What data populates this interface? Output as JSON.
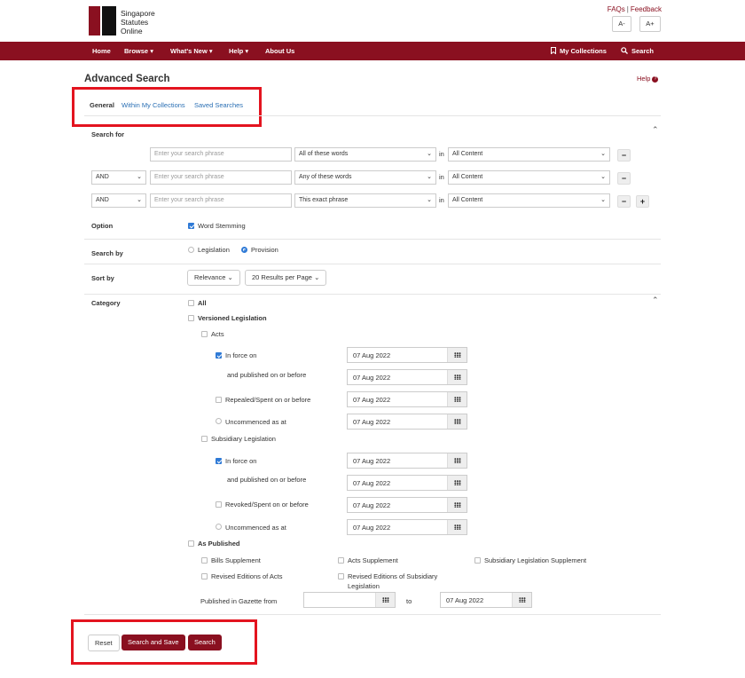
{
  "header": {
    "logo_line1": "Singapore",
    "logo_line2": "Statutes",
    "logo_line3": "Online",
    "faqs": "FAQs",
    "sep": "|",
    "feedback": "Feedback",
    "font_smaller": "A-",
    "font_larger": "A+"
  },
  "nav": {
    "home": "Home",
    "browse": "Browse",
    "whats_new": "What's New",
    "help": "Help",
    "about": "About Us",
    "my_collections": "My Collections",
    "search": "Search",
    "caret": "▾"
  },
  "page": {
    "title": "Advanced Search",
    "help": "Help",
    "help_icon": "?"
  },
  "tabs": {
    "general": "General",
    "within": "Within My Collections",
    "saved": "Saved Searches"
  },
  "search_for": {
    "label": "Search for",
    "in_text": "in",
    "rows": [
      {
        "operator": "",
        "placeholder": "Enter your search phrase",
        "mode": "All of these words",
        "scope": "All Content"
      },
      {
        "operator": "AND",
        "placeholder": "Enter your search phrase",
        "mode": "Any of these words",
        "scope": "All Content"
      },
      {
        "operator": "AND",
        "placeholder": "Enter your search phrase",
        "mode": "This exact phrase",
        "scope": "All Content"
      }
    ],
    "minus": "−",
    "plus": "+"
  },
  "option": {
    "label": "Option",
    "word_stemming": "Word Stemming",
    "word_stemming_checked": true
  },
  "search_by": {
    "label": "Search by",
    "legislation": "Legislation",
    "provision": "Provision",
    "selected": "Provision"
  },
  "sort_by": {
    "label": "Sort by",
    "relevance": "Relevance",
    "per_page": "20 Results per Page"
  },
  "category": {
    "label": "Category",
    "all": "All",
    "versioned": "Versioned Legislation",
    "acts": "Acts",
    "acts_in_force": "In force on",
    "acts_published": "and published on or before",
    "acts_repealed": "Repealed/Spent on or before",
    "acts_uncommenced": "Uncommenced as at",
    "subsidiary": "Subsidiary Legislation",
    "sub_in_force": "In force on",
    "sub_published": "and published on or before",
    "sub_revoked": "Revoked/Spent on or before",
    "sub_uncommenced": "Uncommenced as at",
    "as_published": "As Published",
    "bills_supplement": "Bills Supplement",
    "acts_supplement": "Acts Supplement",
    "sl_supplement": "Subsidiary Legislation Supplement",
    "revised_acts": "Revised Editions of Acts",
    "revised_sl_1": "Revised Editions of Subsidiary",
    "revised_sl_2": "Legislation",
    "gazette_from": "Published in Gazette from",
    "to": "to",
    "gazette_from_value": "",
    "gazette_to_value": "07 Aug 2022",
    "dates": {
      "acts_in_force": "07 Aug 2022",
      "acts_published": "07 Aug 2022",
      "acts_repealed": "07 Aug 2022",
      "acts_uncommenced": "07 Aug 2022",
      "sub_in_force": "07 Aug 2022",
      "sub_published": "07 Aug 2022",
      "sub_revoked": "07 Aug 2022",
      "sub_uncommenced": "07 Aug 2022"
    }
  },
  "actions": {
    "reset": "Reset",
    "search_and_save": "Search and Save",
    "search": "Search"
  },
  "colors": {
    "brand": "#8a1020",
    "link": "#2a6fb4",
    "highlight": "#e3141f",
    "check": "#2f7ad6"
  }
}
